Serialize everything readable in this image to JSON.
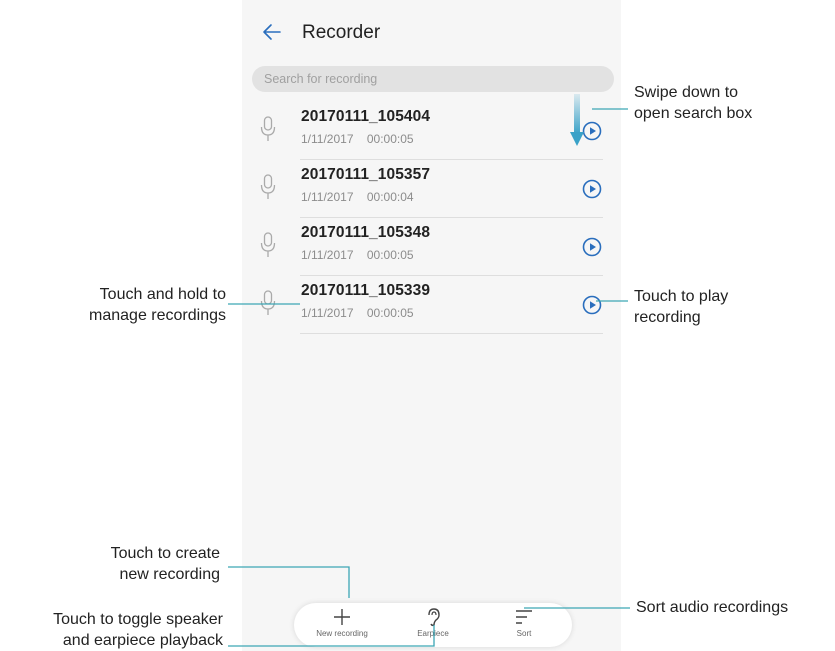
{
  "app": {
    "title": "Recorder",
    "search_placeholder": "Search for recording"
  },
  "recordings": [
    {
      "name": "20170111_105404",
      "date": "1/11/2017",
      "duration": "00:00:05"
    },
    {
      "name": "20170111_105357",
      "date": "1/11/2017",
      "duration": "00:00:04"
    },
    {
      "name": "20170111_105348",
      "date": "1/11/2017",
      "duration": "00:00:05"
    },
    {
      "name": "20170111_105339",
      "date": "1/11/2017",
      "duration": "00:00:05"
    }
  ],
  "toolbar": {
    "new_recording_label": "New recording",
    "earpiece_label": "Earpiece",
    "sort_label": "Sort"
  },
  "callouts": {
    "swipe_line1": "Swipe down to",
    "swipe_line2": "open search box",
    "manage_line1": "Touch and hold to",
    "manage_line2": "manage recordings",
    "play_line1": "Touch to play",
    "play_line2": "recording",
    "create_line1": "Touch to create",
    "create_line2": "new recording",
    "toggle_line1": "Touch to toggle speaker",
    "toggle_line2": "and earpiece playback",
    "sort": "Sort audio recordings"
  },
  "colors": {
    "accent": "#2a6ebd",
    "callout_line": "#3ca6b5",
    "swipe_arrow": "#3aa2c8"
  },
  "icons": {
    "back": "arrow-left-icon",
    "mic": "microphone-icon",
    "play": "play-circle-icon",
    "add": "plus-icon",
    "earpiece": "ear-icon",
    "sort": "sort-icon"
  }
}
